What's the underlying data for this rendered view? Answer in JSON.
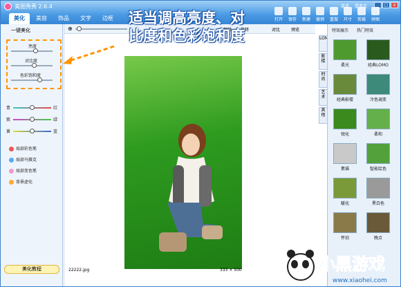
{
  "app": {
    "title": "美图秀秀 2.6.4"
  },
  "tabs": [
    "美化",
    "美容",
    "饰品",
    "文字",
    "边框"
  ],
  "top_links": [
    "菜单",
    "提意见"
  ],
  "toolbar": [
    "打开",
    "保存",
    "新建",
    "撤销",
    "重做",
    "尺寸",
    "剪裁",
    "拼图"
  ],
  "headline": [
    "适当调高亮度、对",
    "比度和色彩饱和度"
  ],
  "left_panel": {
    "one_key": "一键美化",
    "sliders": [
      "亮度",
      "对比度",
      "色彩饱和度"
    ],
    "color_sliders": [
      {
        "left": "青",
        "right": "红"
      },
      {
        "left": "紫",
        "right": "绿"
      },
      {
        "left": "黄",
        "right": "蓝"
      }
    ],
    "tools": [
      "局部彩色笔",
      "局部马赛克",
      "局部变色笔",
      "背景虚化"
    ],
    "tutorial": "美化教程"
  },
  "canvas": {
    "toolbar_items": [
      "翻转",
      "旋转",
      "对比",
      "预览"
    ],
    "filename": "22222.jpg",
    "size": "333 × 500"
  },
  "vertical_tabs": [
    "LOMO",
    "影楼",
    "时尚",
    "艺术",
    "其他"
  ],
  "right_panel": {
    "tabs": [
      "特效展示",
      "热门特效"
    ],
    "effects": [
      "柔光",
      "经典LOMO",
      "经典影楼",
      "冷色调变",
      "锐化",
      "柔和",
      "素描",
      "智能绘色",
      "暖化",
      "黑白色",
      "怀旧",
      "晚点"
    ]
  },
  "watermark": {
    "brand": "小黑游戏",
    "url": "www.xiaohei.com"
  }
}
